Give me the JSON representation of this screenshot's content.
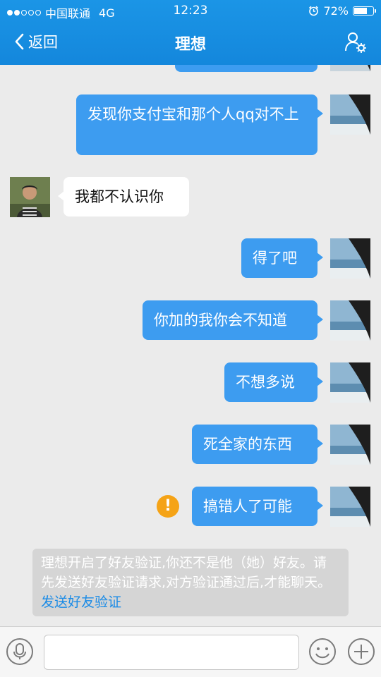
{
  "status_bar": {
    "carrier": "中国联通",
    "network": "4G",
    "time": "12:23",
    "battery_percent": "72%",
    "battery_level": 0.72,
    "signal_strength": 2,
    "signal_max": 5
  },
  "nav": {
    "back_label": "返回",
    "title": "理想"
  },
  "messages": [
    {
      "sender": "me",
      "text": "发现你支付宝和那个人qq对不上"
    },
    {
      "sender": "them",
      "text": "我都不认识你"
    },
    {
      "sender": "me",
      "text": "得了吧"
    },
    {
      "sender": "me",
      "text": "你加的我你会不知道"
    },
    {
      "sender": "me",
      "text": "不想多说"
    },
    {
      "sender": "me",
      "text": "死全家的东西"
    },
    {
      "sender": "me",
      "text": "搞错人了可能",
      "send_failed": true
    }
  ],
  "notice": {
    "text": "理想开启了好友验证,你还不是他（她）好友。请先发送好友验证请求,对方验证通过后,才能聊天。",
    "link": "发送好友验证"
  },
  "input": {
    "placeholder": ""
  },
  "colors": {
    "header": "#1487dc",
    "bubble_me": "#3d9cf0",
    "bubble_them": "#ffffff",
    "background": "#ebebeb",
    "warning": "#f5a316",
    "link": "#1a8be6"
  },
  "icons": [
    "back-chevron-icon",
    "profile-settings-icon",
    "warning-icon",
    "voice-icon",
    "emoji-icon",
    "plus-icon"
  ]
}
